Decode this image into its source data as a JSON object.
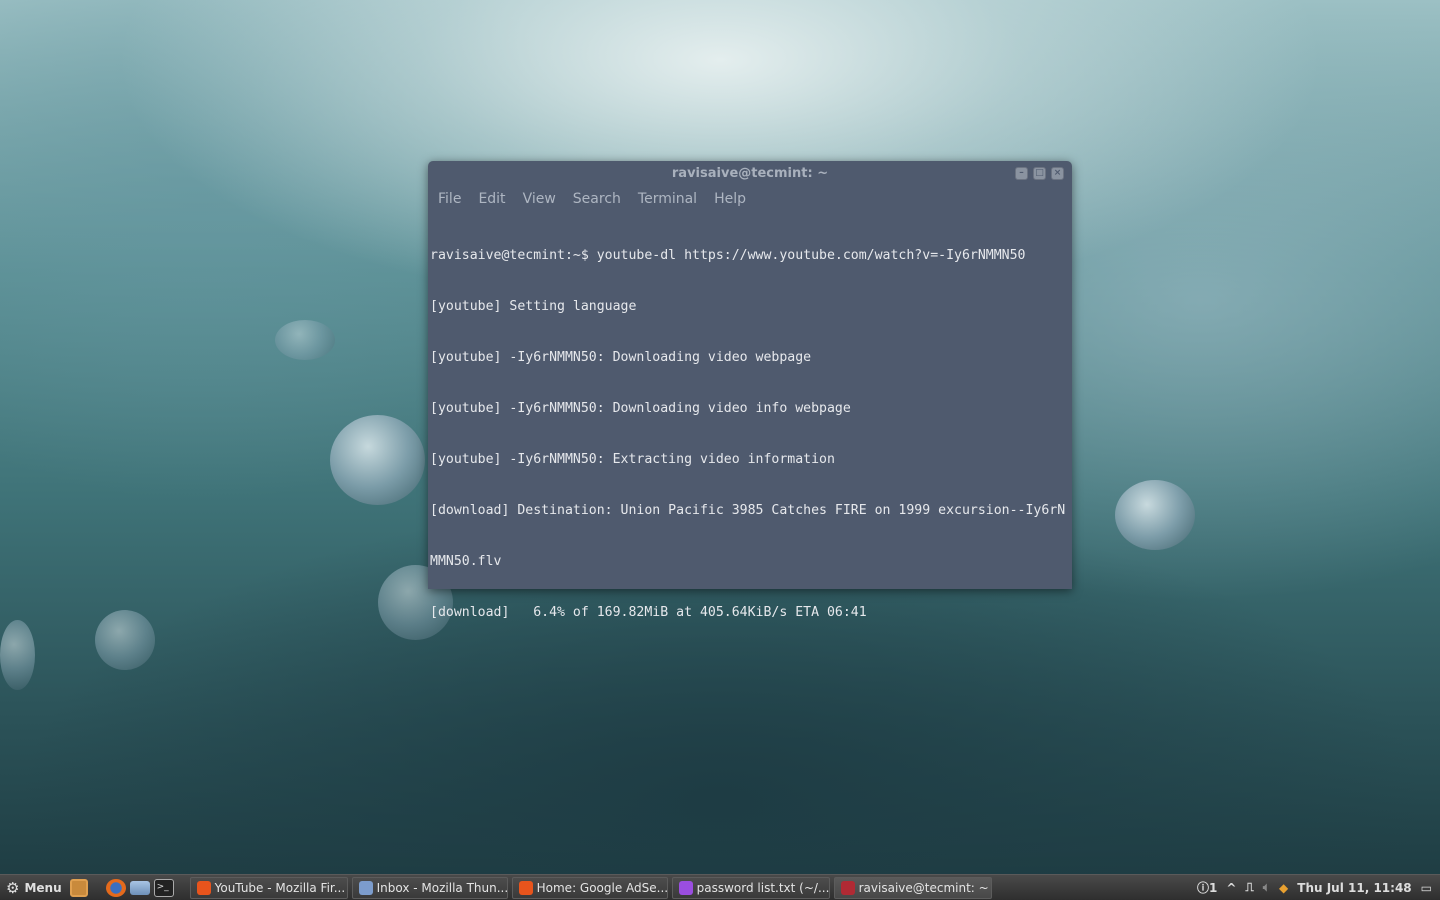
{
  "terminal": {
    "title": "ravisaive@tecmint: ~",
    "menu": [
      "File",
      "Edit",
      "View",
      "Search",
      "Terminal",
      "Help"
    ],
    "lines": [
      "ravisaive@tecmint:~$ youtube-dl https://www.youtube.com/watch?v=-Iy6rNMMN50",
      "[youtube] Setting language",
      "[youtube] -Iy6rNMMN50: Downloading video webpage",
      "[youtube] -Iy6rNMMN50: Downloading video info webpage",
      "[youtube] -Iy6rNMMN50: Extracting video information",
      "[download] Destination: Union Pacific 3985 Catches FIRE on 1999 excursion--Iy6rN",
      "MMN50.flv",
      "[download]   6.4% of 169.82MiB at 405.64KiB/s ETA 06:41"
    ]
  },
  "taskbar": {
    "menu_label": "Menu",
    "tasks": [
      "YouTube - Mozilla Fir...",
      "Inbox - Mozilla Thun...",
      "Home: Google AdSe...",
      "password list.txt (~/...",
      "ravisaive@tecmint: ~"
    ],
    "notification_count": "1",
    "clock": "Thu Jul 11, 11:48"
  }
}
